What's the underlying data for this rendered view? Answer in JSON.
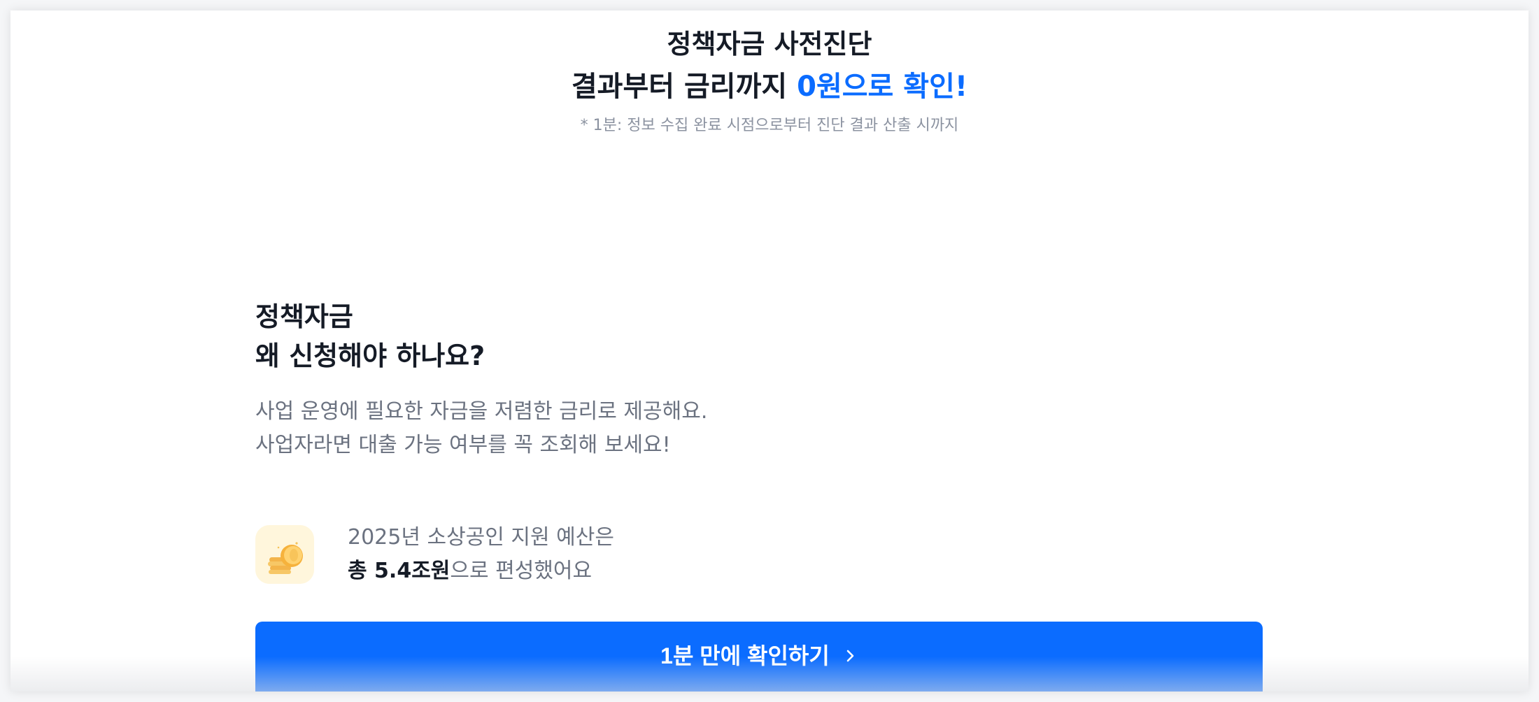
{
  "hero": {
    "title_line1": "정책자금 사전진단",
    "title_line2_prefix": "결과부터 금리까지 ",
    "title_line2_accent": "0원으로 확인!",
    "note": "* 1분: 정보 수집 완료 시점으로부터 진단 결과 산출 시까지"
  },
  "why": {
    "title_line1": "정책자금",
    "title_line2": "왜 신청해야 하나요?",
    "desc_line1": "사업 운영에 필요한 자금을 저렴한 금리로 제공해요.",
    "desc_line2": "사업자라면 대출 가능 여부를 꼭 조회해 보세요!"
  },
  "budget": {
    "icon": "coin-stack-icon",
    "line1": "2025년 소상공인 지원 예산은",
    "line2_strong": "총 5.4조원",
    "line2_rest": "으로 편성했어요"
  },
  "cta": {
    "label": "1분 만에 확인하기",
    "icon": "chevron-right-icon"
  },
  "colors": {
    "accent": "#0b6cff",
    "text_primary": "#151b26",
    "text_secondary": "#6b7280",
    "note": "#8b92a0",
    "coin_tile_bg": "#fff6dc"
  }
}
